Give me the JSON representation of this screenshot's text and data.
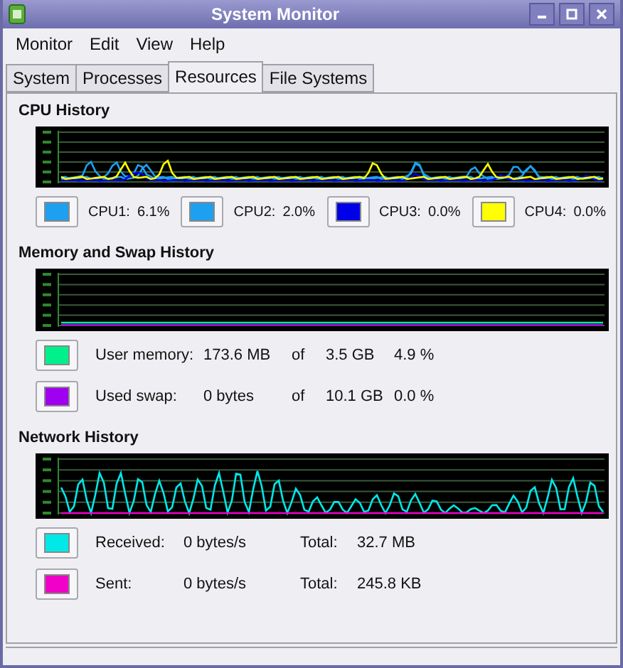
{
  "window": {
    "title": "System Monitor"
  },
  "menu": [
    "Monitor",
    "Edit",
    "View",
    "Help"
  ],
  "tabs": [
    {
      "label": "System",
      "selected": false
    },
    {
      "label": "Processes",
      "selected": false
    },
    {
      "label": "Resources",
      "selected": true
    },
    {
      "label": "File Systems",
      "selected": false
    }
  ],
  "sections": [
    {
      "kind": "cpu",
      "title": "CPU History",
      "legend": [
        {
          "color": "#1ea0f0",
          "fields": [
            "CPU1:",
            "6.1%"
          ]
        },
        {
          "color": "#1ea0f0",
          "fields": [
            "CPU2:",
            "2.0%"
          ]
        },
        {
          "color": "#0000e8",
          "fields": [
            "CPU3:",
            "0.0%"
          ]
        },
        {
          "color": "#ffff00",
          "fields": [
            "CPU4:",
            "0.0%"
          ]
        }
      ]
    },
    {
      "kind": "memory",
      "title": "Memory and Swap History",
      "legend": [
        {
          "color": "#00f08c",
          "fields": [
            "User memory:",
            "173.6 MB",
            "of",
            "3.5 GB",
            "4.9 %"
          ]
        },
        {
          "color": "#a000f0",
          "fields": [
            "Used swap:",
            "0 bytes",
            "of",
            "10.1 GB",
            "0.0 %"
          ]
        }
      ]
    },
    {
      "kind": "network",
      "title": "Network History",
      "legend": [
        {
          "color": "#00e8e8",
          "fields": [
            "Received:",
            "0 bytes/s",
            "Total:",
            "32.7 MB"
          ]
        },
        {
          "color": "#f000c8",
          "fields": [
            "Sent:",
            "0 bytes/s",
            "Total:",
            "245.8 KB"
          ]
        }
      ]
    }
  ]
}
